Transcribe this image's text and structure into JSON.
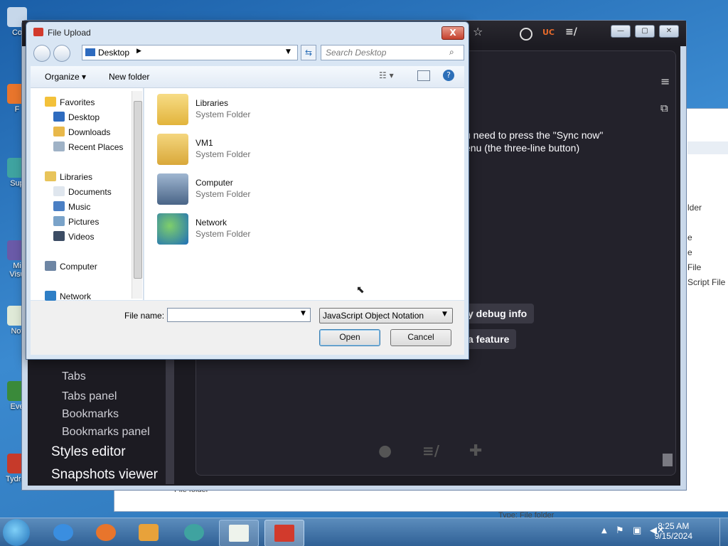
{
  "desktop": {
    "icons": [
      "Co",
      "F",
      "Sup",
      "Mi Visu",
      "Not",
      "Eve",
      "Tydrox"
    ]
  },
  "background_explorer": {
    "rows": [
      "e",
      "e",
      "File",
      "Script File"
    ],
    "header_fragment": "lder",
    "bottom_label": "File folder",
    "type_label": "Type:  File folder"
  },
  "firefox": {
    "toolbar_icons": [
      "star-icon",
      "account-icon",
      "uc-icon",
      "library-icon"
    ],
    "content_text_1": "u need to press the \"Sync now\"",
    "content_text_2": "enu (the three-line button)",
    "buttons": [
      "y debug info",
      "a feature"
    ],
    "sidebar": {
      "items_small": [
        "Tabs",
        "Tabs panel",
        "Bookmarks",
        "Bookmarks panel"
      ],
      "items_large": [
        "Styles editor",
        "Snapshots viewer"
      ]
    }
  },
  "dialog": {
    "title": "File Upload",
    "close": "X",
    "location": "Desktop",
    "search_placeholder": "Search Desktop",
    "toolbar": {
      "organize": "Organize ▾",
      "new_folder": "New folder"
    },
    "nav": {
      "favorites": "Favorites",
      "favorites_items": [
        "Desktop",
        "Downloads",
        "Recent Places"
      ],
      "libraries": "Libraries",
      "libraries_items": [
        "Documents",
        "Music",
        "Pictures",
        "Videos"
      ],
      "computer": "Computer",
      "network": "Network"
    },
    "files": [
      {
        "name": "Libraries",
        "type": "System Folder"
      },
      {
        "name": "VM1",
        "type": "System Folder"
      },
      {
        "name": "Computer",
        "type": "System Folder"
      },
      {
        "name": "Network",
        "type": "System Folder"
      }
    ],
    "filename_label": "File name:",
    "filename_value": "",
    "filetype": "JavaScript Object Notation",
    "open": "Open",
    "cancel": "Cancel"
  },
  "taskbar": {
    "time": "8:25 AM",
    "date": "9/15/2024"
  }
}
